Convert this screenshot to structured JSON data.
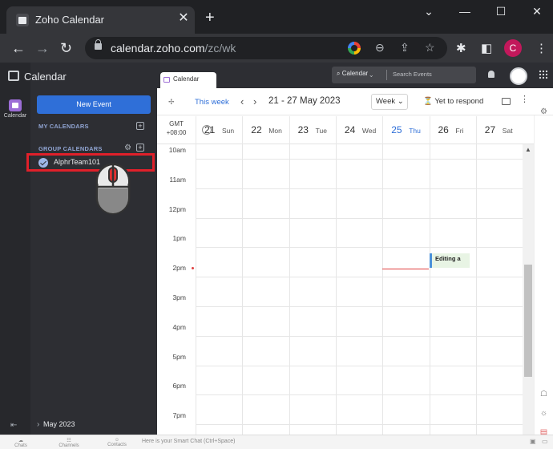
{
  "browser": {
    "tab_title": "Zoho Calendar",
    "tab_close": "✕",
    "new_tab": "+",
    "window_minimize": "⌄",
    "window_min2": "—",
    "window_restore": "☐",
    "window_close": "✕",
    "nav_back": "←",
    "nav_forward": "→",
    "nav_reload": "↻",
    "url_host": "calendar.zoho.com",
    "url_path": "/zc/wk",
    "profile_initial": "C",
    "icons": [
      "google-icon",
      "zoom-icon",
      "share-icon",
      "bookmark-star-icon",
      "extensions-icon",
      "sidepanel-icon"
    ]
  },
  "sidebar": {
    "app_title": "Calendar",
    "rail_label": "Calendar",
    "new_event_label": "New Event",
    "my_calendars_label": "MY CALENDARS",
    "group_calendars_label": "GROUP CALENDARS",
    "group_items": [
      {
        "label": "AlphrTeam101",
        "checked": true
      }
    ],
    "month_label": "May 2023"
  },
  "topbar": {
    "tab_label": "Calendar",
    "search_scope": "Calendar ⌄",
    "search_placeholder": "Search Events"
  },
  "toolbar": {
    "this_week_label": "This week",
    "date_range": "21 - 27 May 2023",
    "view_label": "Week ⌄",
    "filter_label": "Yet to respond"
  },
  "timezone": {
    "line1": "GMT",
    "line2": "+08:00"
  },
  "days": [
    {
      "num": "21",
      "name": "Sun",
      "today": false
    },
    {
      "num": "22",
      "name": "Mon",
      "today": false
    },
    {
      "num": "23",
      "name": "Tue",
      "today": false
    },
    {
      "num": "24",
      "name": "Wed",
      "today": false
    },
    {
      "num": "25",
      "name": "Thu",
      "today": true
    },
    {
      "num": "26",
      "name": "Fri",
      "today": false
    },
    {
      "num": "27",
      "name": "Sat",
      "today": false
    }
  ],
  "hours": [
    "10am",
    "11am",
    "12pm",
    "1pm",
    "2pm",
    "3pm",
    "4pm",
    "5pm",
    "6pm",
    "7pm"
  ],
  "event": {
    "title": "Editing a",
    "day": "Fri"
  },
  "bottombar": {
    "items": [
      "Chats",
      "Channels",
      "Contacts"
    ],
    "smart_chat": "Here is your Smart Chat (Ctrl+Space)"
  },
  "colors": {
    "accent": "#2f6fd8",
    "highlight": "#e0202a",
    "event_bg": "#e8f4e4",
    "now_line": "#e04040"
  }
}
